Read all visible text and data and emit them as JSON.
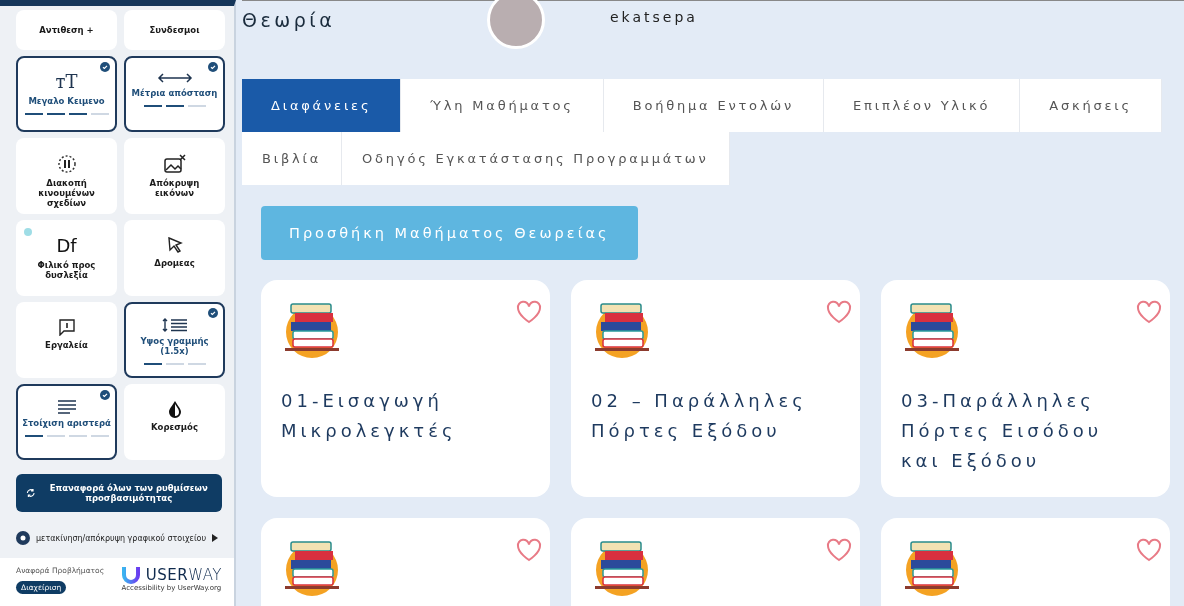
{
  "accessibility_panel": {
    "tiles": [
      {
        "label": "Αντιθεση +",
        "kind": "plain",
        "active": false
      },
      {
        "label": "Συνδεσμοι",
        "kind": "plain",
        "active": false
      },
      {
        "label": "Μεγαλο Κειμενο",
        "kind": "text-size",
        "glyph": "тT",
        "active": true,
        "segments": [
          {
            "filled": true
          },
          {
            "filled": true
          },
          {
            "filled": true
          },
          {
            "filled": false
          }
        ]
      },
      {
        "label": "Μέτρια απόσταση",
        "kind": "spacing",
        "active": true,
        "segments": [
          {
            "filled": true
          },
          {
            "filled": true
          },
          {
            "filled": false
          }
        ]
      },
      {
        "label": "Διακοπή κινουμένων σχεδίων",
        "kind": "pause",
        "active": false
      },
      {
        "label": "Απόκρυψη εικόνων",
        "kind": "hide-images",
        "active": false
      },
      {
        "label": "Φιλικό προς δυσλεξία",
        "kind": "dyslexia",
        "glyph": "Df",
        "active": false,
        "info_badge": true
      },
      {
        "label": "Δρομεας",
        "kind": "cursor",
        "active": false
      },
      {
        "label": "Εργαλεία",
        "kind": "tools",
        "active": false
      },
      {
        "label": "Υψος γραμμής (1.5x)",
        "kind": "line-height",
        "active": true,
        "segments": [
          {
            "filled": true
          },
          {
            "filled": false
          },
          {
            "filled": false
          }
        ]
      },
      {
        "label": "Στοίχιση αριστερά",
        "kind": "align",
        "active": true,
        "segments": [
          {
            "filled": true
          },
          {
            "filled": false
          },
          {
            "filled": false
          },
          {
            "filled": false
          }
        ]
      },
      {
        "label": "Κορεσμός",
        "kind": "saturation",
        "active": false
      }
    ],
    "reset_button": "Επαναφορά όλων των ρυθμίσεων προσβασιμότητας",
    "move_widget": "μετακίνηση/απόκρυψη γραφικού στοιχείου",
    "footer": {
      "report_link": "Αναφορά Προβλήματος",
      "manage_button": "Διαχείριση",
      "brand": "**USER**WAY",
      "brand_sub": "Accessibility by UserWay.org"
    }
  },
  "header": {
    "title": "Θεωρία",
    "username": "ekatsepa"
  },
  "tab_rows": [
    [
      {
        "label": "Διαφάνειες",
        "selected": true
      },
      {
        "label": "Ύλη Μαθήματος",
        "selected": false
      },
      {
        "label": "Βοήθημα Εντολών",
        "selected": false
      },
      {
        "label": "Επιπλέον Υλικό",
        "selected": false
      },
      {
        "label": "Ασκήσεις",
        "selected": false
      }
    ],
    [
      {
        "label": "Βιβλία",
        "selected": false
      },
      {
        "label": "Οδηγός Εγκατάστασης Προγραμμάτων",
        "selected": false
      }
    ]
  ],
  "add_button": "Προσθήκη Μαθήματος Θεωρείας",
  "cards": [
    {
      "title": "01-Εισαγωγή Μικρολεγκτές",
      "favorite": false
    },
    {
      "title": "02 – Παράλληλες Πόρτες Εξόδου",
      "favorite": false
    },
    {
      "title": "03-Παράλληλες Πόρτες Εισόδου και Εξόδου",
      "favorite": false
    },
    {
      "favorite": false
    },
    {
      "favorite": false
    },
    {
      "favorite": false
    }
  ]
}
